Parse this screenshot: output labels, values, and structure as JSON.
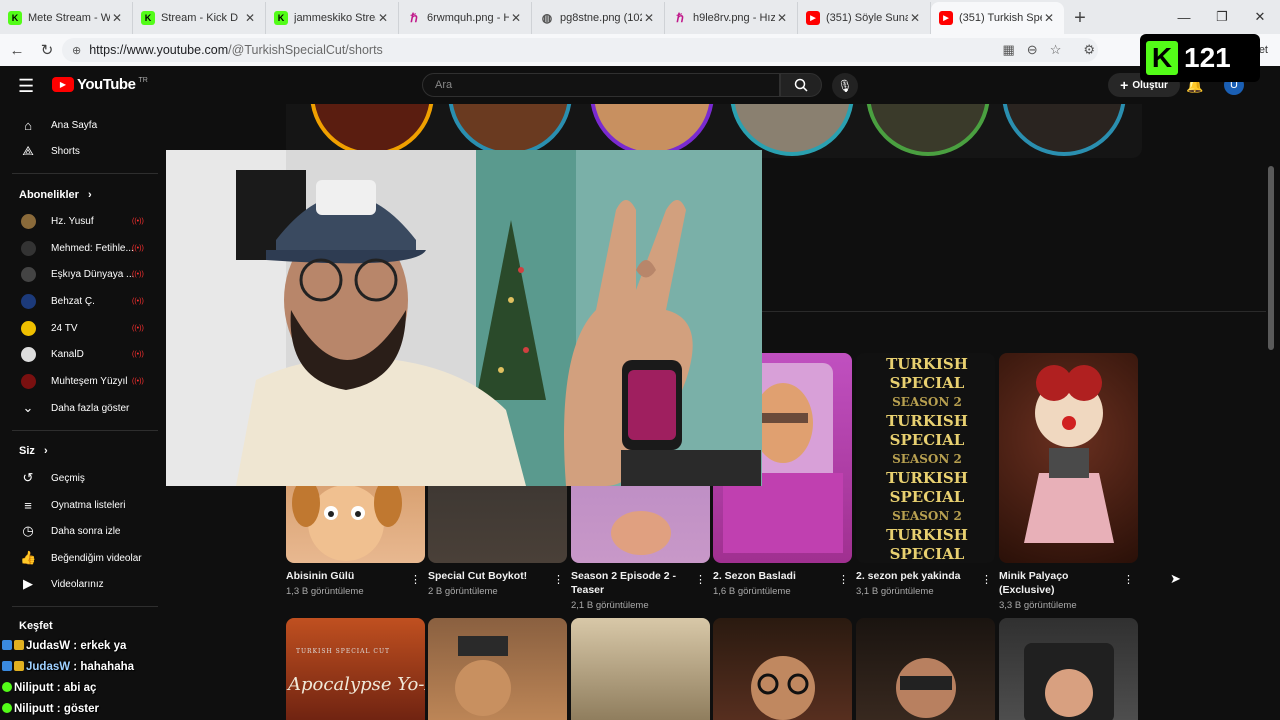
{
  "browser": {
    "tabs": [
      {
        "title": "Mete Stream - Wat",
        "favicon": "kick-icon",
        "color": "#53fc18"
      },
      {
        "title": "Stream - Kick D",
        "favicon": "kick-icon",
        "color": "#53fc18"
      },
      {
        "title": "jammeskiko Stream",
        "favicon": "kick-icon",
        "color": "#53fc18"
      },
      {
        "title": "6rwmquh.png - Hız",
        "favicon": "hizli-icon",
        "color": "#c0188a"
      },
      {
        "title": "pg8stne.png (1024",
        "favicon": "globe-icon",
        "color": "#777777"
      },
      {
        "title": "h9le8rv.png - Hızlı",
        "favicon": "hizli-icon",
        "color": "#c0188a"
      },
      {
        "title": "(351) Söyle Sunam",
        "favicon": "youtube-icon",
        "color": "#ff0000"
      },
      {
        "title": "(351) Turkish Speci",
        "favicon": "youtube-icon",
        "color": "#ff0000"
      }
    ],
    "url_base": "https://www.youtube.com",
    "url_path": "/@TurkishSpecialCut/shorts",
    "overlay_number": "121",
    "overlay_text": "ohbet et"
  },
  "youtube": {
    "logo_text": "YouTube",
    "logo_region": "TR",
    "search_placeholder": "Ara",
    "create_label": "Oluştur",
    "notification_count": "9+",
    "avatar_letter": "U",
    "sidebar": {
      "main": [
        {
          "label": "Ana Sayfa",
          "icon": "home-icon"
        },
        {
          "label": "Shorts",
          "icon": "shorts-icon"
        }
      ],
      "subscriptions_header": "Abonelikler",
      "subscriptions": [
        {
          "label": "Hz. Yusuf",
          "color": "#8a6a3a"
        },
        {
          "label": "Mehmed: Fetihle...",
          "color": "#333333"
        },
        {
          "label": "Eşkıya Dünyaya ...",
          "color": "#444444"
        },
        {
          "label": "Behzat Ç.",
          "color": "#1c3a7a"
        },
        {
          "label": "24 TV",
          "color": "#f0c000"
        },
        {
          "label": "KanalD",
          "color": "#dddddd"
        },
        {
          "label": "Muhteşem Yüzyıl",
          "color": "#7a1010"
        }
      ],
      "show_more": "Daha fazla göster",
      "you_header": "Siz",
      "you_items": [
        {
          "label": "Geçmiş",
          "icon": "history-icon"
        },
        {
          "label": "Oynatma listeleri",
          "icon": "playlist-icon"
        },
        {
          "label": "Daha sonra izle",
          "icon": "clock-icon"
        },
        {
          "label": "Beğendiğim videolar",
          "icon": "thumb-up-icon"
        },
        {
          "label": "Videolarınız",
          "icon": "video-icon"
        }
      ],
      "explore_header": "Keşfet"
    },
    "shorts_row1": [
      {
        "title": "Abisinin Gülü",
        "views": "1,3 B görüntüleme"
      },
      {
        "title": "Special Cut Boykot!",
        "views": "2 B görüntüleme"
      },
      {
        "title": "Season 2 Episode 2 - Teaser",
        "views": "2,1 B görüntüleme"
      },
      {
        "title": "2. Sezon Basladi",
        "views": "1,6 B görüntüleme"
      },
      {
        "title": "2. sezon pek yakinda",
        "views": "3,1 B görüntüleme"
      },
      {
        "title": "Minik Palyaço (Exclusive)",
        "views": "3,3 B görüntüleme"
      }
    ],
    "poster_text": "TURKISH SPECIAL",
    "poster_sub": "SEASON 2",
    "apocalypse_text": "Apocalypse Yo-Now",
    "apocalypse_small": "TURKISH SPECIAL CUT"
  },
  "chat": [
    {
      "user": "JudasW",
      "message": "erkek ya"
    },
    {
      "user": "JudasW",
      "message": "hahahaha"
    },
    {
      "user": "Niliputt",
      "message": "abi aç"
    },
    {
      "user": "Niliputt",
      "message": "göster"
    }
  ]
}
